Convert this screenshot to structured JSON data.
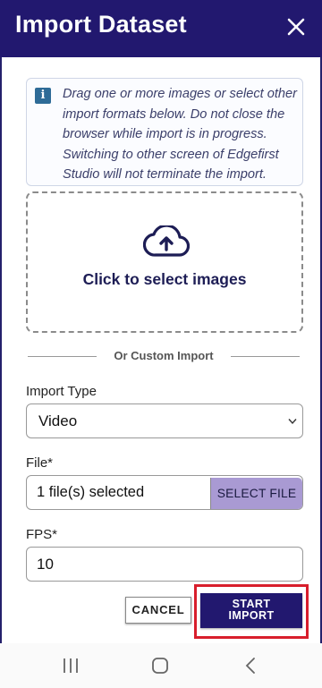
{
  "header": {
    "title": "Import Dataset",
    "close_icon": "close-icon"
  },
  "info": {
    "icon": "info-icon",
    "icon_glyph": "i",
    "text": "Drag one or more images or select other import formats below. Do not close the browser while import is in progress. Switching to other screen of Edgefirst Studio will not terminate the import."
  },
  "dropzone": {
    "icon": "cloud-upload-icon",
    "label": "Click to select images"
  },
  "divider": {
    "text": "Or Custom Import"
  },
  "import_type": {
    "label": "Import Type",
    "value": "Video",
    "icon": "chevron-down-icon"
  },
  "file": {
    "label": "File*",
    "value": "1 file(s) selected",
    "button_label": "SELECT FILE"
  },
  "fps": {
    "label": "FPS*",
    "value": "10"
  },
  "actions": {
    "cancel_label": "CANCEL",
    "start_label_line1": "START",
    "start_label_line2": "IMPORT"
  },
  "navbar": {
    "items": [
      "recent-apps-icon",
      "home-icon",
      "back-icon"
    ]
  },
  "colors": {
    "primary": "#22186f",
    "select_file_bg": "#a99ad3",
    "highlight": "#d81e2c",
    "info_icon": "#2e6b97"
  }
}
